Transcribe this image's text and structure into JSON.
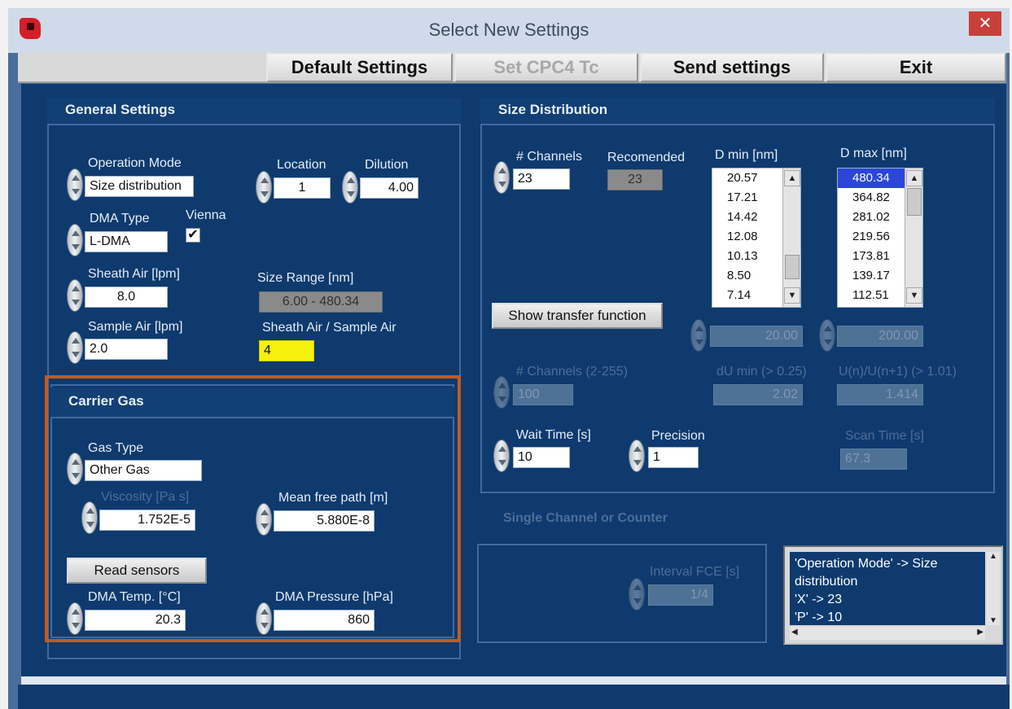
{
  "window": {
    "title": "Select New Settings",
    "close_glyph": "✕"
  },
  "toolbar": {
    "default_settings": "Default Settings",
    "set_cpc4_tc": "Set CPC4 Tc",
    "send_settings": "Send settings",
    "exit": "Exit"
  },
  "general": {
    "title": "General Settings",
    "operation_mode_label": "Operation Mode",
    "operation_mode_value": "Size distribution",
    "location_label": "Location",
    "location_value": "1",
    "dilution_label": "Dilution",
    "dilution_value": "4.00",
    "dma_type_label": "DMA Type",
    "dma_type_value": "L-DMA",
    "vienna_label": "Vienna",
    "vienna_checked": true,
    "vienna_check_glyph": "✔",
    "sheath_air_label": "Sheath Air [lpm]",
    "sheath_air_value": "8.0",
    "size_range_label": "Size Range [nm]",
    "size_range_value": "6.00 - 480.34",
    "sample_air_label": "Sample Air [lpm]",
    "sample_air_value": "2.0",
    "ratio_label": "Sheath Air / Sample Air",
    "ratio_value": "4"
  },
  "carrier": {
    "title": "Carrier Gas",
    "gas_type_label": "Gas Type",
    "gas_type_value": "Other Gas",
    "viscosity_label": "Viscosity [Pa s]",
    "viscosity_value": "1.752E-5",
    "mfp_label": "Mean free path [m]",
    "mfp_value": "5.880E-8",
    "read_sensors": "Read sensors",
    "dma_temp_label": "DMA Temp. [°C]",
    "dma_temp_value": "20.3",
    "dma_pressure_label": "DMA Pressure [hPa]",
    "dma_pressure_value": "860"
  },
  "size_dist": {
    "title": "Size Distribution",
    "channels_label": "# Channels",
    "channels_value": "23",
    "recommended_label": "Recomended",
    "recommended_value": "23",
    "dmin_label": "D min [nm]",
    "dmin_items": [
      "20.57",
      "17.21",
      "14.42",
      "12.08",
      "10.13",
      "8.50",
      "7.14"
    ],
    "dmin_field": "20.00",
    "dmax_label": "D max [nm]",
    "dmax_items": [
      "480.34",
      "364.82",
      "281.02",
      "219.56",
      "173.81",
      "139.17",
      "112.51"
    ],
    "dmax_field": "200.00",
    "show_transfer": "Show transfer function",
    "channels2_label": "# Channels (2-255)",
    "channels2_value": "100",
    "dlnd_label": "dU min (> 0.25)",
    "dlnd_value": "2.02",
    "ratio_label": "U(n)/U(n+1) (> 1.01)",
    "ratio_value": "1.414",
    "wait_time_label": "Wait Time [s]",
    "wait_time_value": "10",
    "precision_label": "Precision",
    "precision_value": "1",
    "scan_time_label": "Scan Time [s]",
    "scan_time_value": "67.3"
  },
  "single": {
    "title": "Single Channel or Counter",
    "interval_label": "Interval FCE [s]",
    "interval_value": "1/4"
  },
  "log": {
    "text": "'Operation Mode' -> Size distribution\n'X' -> 23\n'P' -> 10"
  },
  "colors": {
    "client_bg": "#0e3a6e",
    "highlight_border": "#c65a1a",
    "ratio_highlight": "#f6f20d",
    "selection": "#2b46d8"
  }
}
